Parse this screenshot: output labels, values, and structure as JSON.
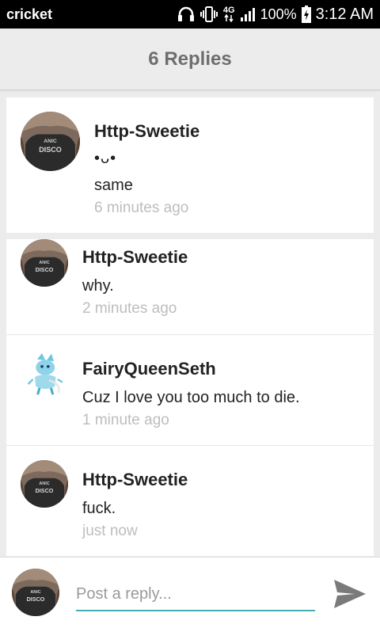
{
  "status_bar": {
    "carrier": "cricket",
    "network": "4G",
    "battery": "100%",
    "time": "3:12 AM",
    "icons": [
      "headphones-icon",
      "vibrate-icon",
      "network-arrows-icon",
      "signal-icon",
      "battery-charging-icon"
    ]
  },
  "header": {
    "title": "6 Replies"
  },
  "replies": [
    {
      "username": "Http-Sweetie",
      "emoticon": "•ᴗ•",
      "message": "same",
      "time": "6 minutes ago"
    },
    {
      "username": "Http-Sweetie",
      "message": "why.",
      "time": "2 minutes ago"
    },
    {
      "username": "FairyQueenSeth",
      "message": "Cuz I love you too much to die.",
      "time": "1 minute ago"
    },
    {
      "username": "Http-Sweetie",
      "message": "fuck.",
      "time": "just now"
    }
  ],
  "avatar_shirt_text": [
    "ANIC",
    "DISCO"
  ],
  "reply_bar": {
    "placeholder": "Post a reply...",
    "send_icon": "send-icon"
  },
  "colors": {
    "accent": "#3fb1b5",
    "timestamp": "#bdbdbd",
    "background": "#ececec"
  }
}
